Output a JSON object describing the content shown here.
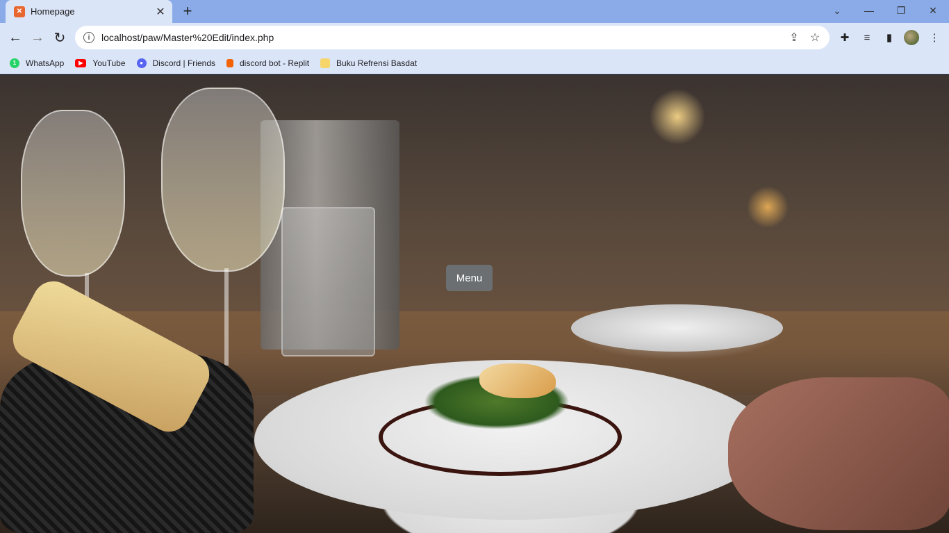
{
  "browser": {
    "tab": {
      "title": "Homepage",
      "favicon": "xampp-icon"
    },
    "new_tab_label": "+",
    "window_controls": {
      "minimize": "—",
      "restore": "❐",
      "close": "✕",
      "tab_search": "⌄"
    },
    "address": {
      "url": "localhost/paw/Master%20Edit/index.php"
    },
    "bookmarks": [
      {
        "label": "WhatsApp",
        "icon": "whatsapp-icon",
        "color": "#25d366"
      },
      {
        "label": "YouTube",
        "icon": "youtube-icon",
        "color": "#ff0000"
      },
      {
        "label": "Discord | Friends",
        "icon": "discord-icon",
        "color": "#5865f2"
      },
      {
        "label": "discord bot - Replit",
        "icon": "replit-icon",
        "color": "#f26207"
      },
      {
        "label": "Buku Refrensi Basdat",
        "icon": "folder-icon",
        "color": "#f6d56b"
      }
    ]
  },
  "page": {
    "menu_button_label": "Menu",
    "background": "restaurant-table-photo"
  },
  "colors": {
    "tab_strip": "#8aabe8",
    "toolbar": "#dbe5f8",
    "menu_button": "#6b6f72"
  }
}
